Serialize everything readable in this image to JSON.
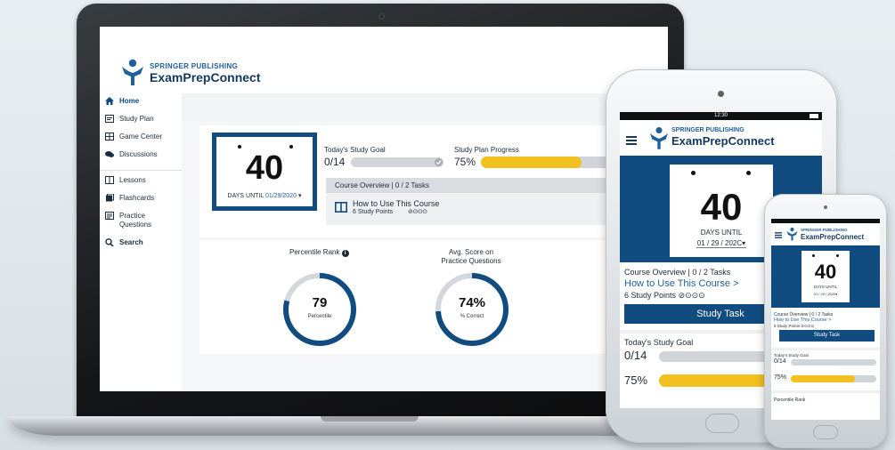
{
  "brand": {
    "top": "SPRINGER PUBLISHING",
    "main_a": "ExamPrep",
    "main_b": "Connect",
    "color_primary": "#114c80",
    "color_accent": "#f2c01f"
  },
  "sidebar": {
    "items": [
      {
        "label": "Home",
        "icon": "home-icon",
        "active": true
      },
      {
        "label": "Study Plan",
        "icon": "calendar-icon"
      },
      {
        "label": "Game Center",
        "icon": "game-grid-icon"
      },
      {
        "label": "Discussions",
        "icon": "chat-bubbles-icon"
      },
      {
        "label": "Lessons",
        "icon": "open-book-icon"
      },
      {
        "label": "Flashcards",
        "icon": "flashcards-icon"
      },
      {
        "label": "Practice",
        "label2": "Questions",
        "icon": "checklist-icon"
      },
      {
        "label": "Search",
        "icon": "search-icon"
      }
    ]
  },
  "countdown": {
    "number": "40",
    "label": "DAYS UNTIL",
    "date": "01/29/2020",
    "tablet_date": "01 / 29 / 202C",
    "phone_date": "01 / 29 / 2020"
  },
  "study_goal": {
    "title": "Today's Study Goal",
    "value": "0/14",
    "progress": 0
  },
  "plan_progress": {
    "title": "Study Plan Progress",
    "value": "75%",
    "progress": 0.75
  },
  "course": {
    "overview": "Course Overview | 0 / 2 Tasks",
    "lesson_title": "How to Use This Course",
    "tablet_lesson_title": "How to Use This Course >",
    "study_points": "6 Study Points",
    "study_task_button": "Study Task"
  },
  "metrics": {
    "percentile_title": "Percentile Rank",
    "percentile_value": "79",
    "percentile_caption": "Percentile",
    "percentile_fraction": 0.79,
    "avg_title_1": "Avg. Score on",
    "avg_title_2": "Practice Questions",
    "avg_value": "74%",
    "avg_caption": "% Correct",
    "avg_fraction": 0.74
  },
  "tablet": {
    "time": "12:30"
  },
  "phone": {
    "percentile_label": "Percentile Rank"
  }
}
